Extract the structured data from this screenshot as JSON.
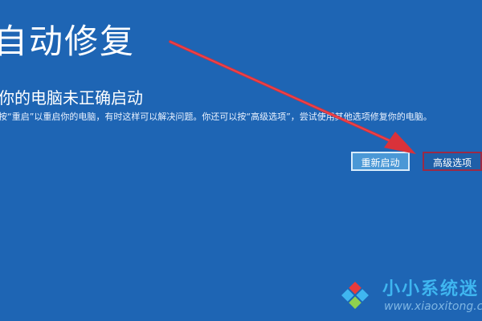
{
  "screen": {
    "title": "自动修复",
    "subtitle": "你的电脑未正确启动",
    "description": "按“重启”以重启你的电脑，有时这样可以解决问题。你还可以按“高级选项”，尝试使用其他选项修复你的电脑。"
  },
  "buttons": {
    "restart_label": "重新启动",
    "advanced_label": "高级选项"
  },
  "watermark": {
    "name": "小小系统迷",
    "url": "www.xiaoxitong.com"
  },
  "colors": {
    "background": "#1e65b4",
    "arrow": "#d9323a",
    "highlight_border": "#9c2a45",
    "primary_button": "#4a98d6"
  },
  "icons": {
    "arrow": "red-pointer-arrow-icon",
    "logo": "windows-tiles-logo-icon"
  }
}
